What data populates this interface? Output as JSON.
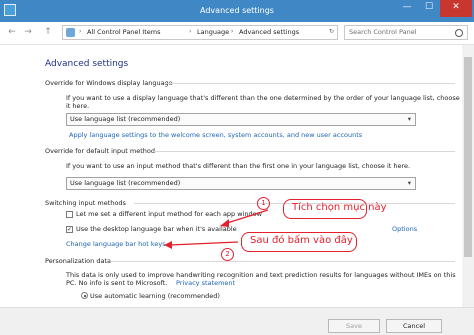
{
  "window": {
    "title": "Advanced settings",
    "min": "—",
    "max": "☐",
    "close": "✕"
  },
  "nav": {
    "back": "←",
    "forward": "→",
    "up": "↑",
    "breadcrumbs": [
      "All Control Panel Items",
      "Language",
      "Advanced settings"
    ],
    "search_placeholder": "Search Control Panel"
  },
  "page": {
    "heading": "Advanced settings"
  },
  "display_language": {
    "title": "Override for Windows display language",
    "description_1": "If you want to use a display language that's different than the one determined by the order of your language list, choose",
    "description_2": "it here.",
    "dropdown_value": "Use language list (recommended)",
    "link": "Apply language settings to the welcome screen, system accounts, and new user accounts"
  },
  "input_method": {
    "title": "Override for default input method",
    "description": "If you want to use an input method that's different than the first one in your language list, choose it here.",
    "dropdown_value": "Use language list (recommended)"
  },
  "switching": {
    "title": "Switching input methods",
    "option_1": "Let me set a different input method for each app window",
    "option_2": "Use the desktop language bar when it's available",
    "options_link": "Options",
    "hotkeys_link": "Change language bar hot keys"
  },
  "annotations": {
    "callout_1": "Tích chọn mục này",
    "callout_2": "Sau đó bấm vào đây",
    "num_1": "1",
    "num_2": "2"
  },
  "personalization": {
    "title": "Personalization data",
    "description_1": "This data is only used to improve handwriting recognition and text prediction results for languages without IMEs on this",
    "description_2": "PC. No info is sent to Microsoft.",
    "privacy_link": "Privacy statement",
    "radio_label": "Use automatic learning (recommended)"
  },
  "footer": {
    "save": "Save",
    "cancel": "Cancel"
  },
  "colors": {
    "title_bar": "#3f88c5",
    "annotation_red": "#e5202d",
    "link_blue": "#1c64b4"
  }
}
